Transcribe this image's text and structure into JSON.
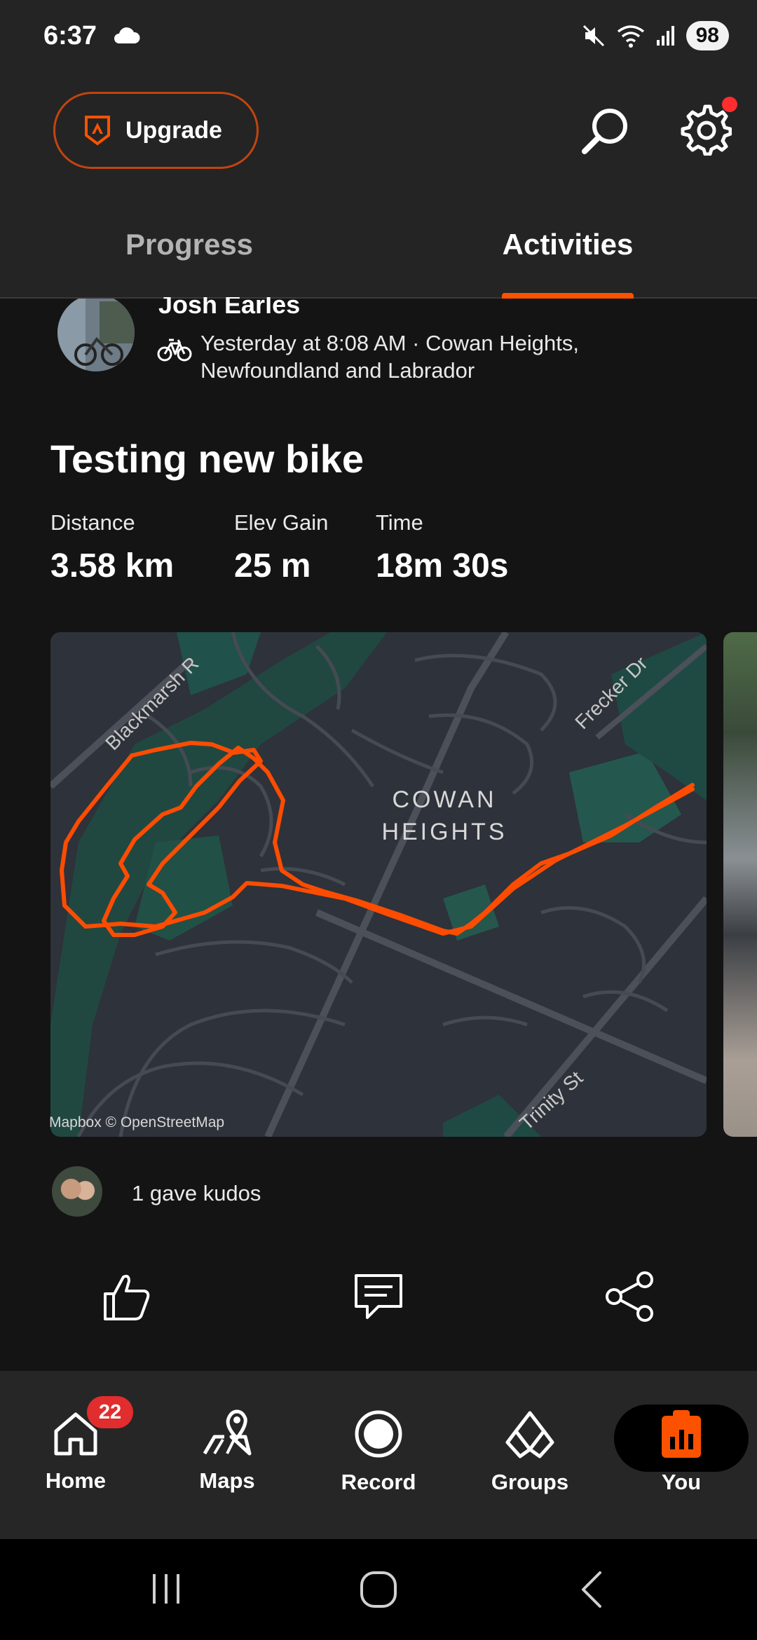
{
  "status_bar": {
    "time": "6:37",
    "battery": "98",
    "icons": [
      "cloud-icon",
      "mute-icon",
      "wifi-icon",
      "signal-icon"
    ]
  },
  "header": {
    "upgrade_label": "Upgrade",
    "tabs": [
      {
        "label": "Progress",
        "active": false
      },
      {
        "label": "Activities",
        "active": true
      }
    ],
    "accent_color": "#fc5200"
  },
  "activity": {
    "athlete": "Josh Earles",
    "meta": "Yesterday at 8:08 AM · Cowan Heights, Newfoundland and Labrador",
    "title": "Testing new bike",
    "stats": [
      {
        "label": "Distance",
        "value": "3.58 km"
      },
      {
        "label": "Elev Gain",
        "value": "25 m"
      },
      {
        "label": "Time",
        "value": "18m 30s"
      }
    ],
    "map": {
      "area_label_1": "COWAN",
      "area_label_2": "HEIGHTS",
      "streets": [
        "Blackmarsh R",
        "Frecker Dr",
        "Trinity St"
      ],
      "attribution": "Mapbox © OpenStreetMap"
    },
    "kudos_text": "1 gave kudos"
  },
  "bottom_nav": {
    "items": [
      {
        "label": "Home",
        "badge": "22"
      },
      {
        "label": "Maps"
      },
      {
        "label": "Record"
      },
      {
        "label": "Groups"
      },
      {
        "label": "You",
        "active": true
      }
    ]
  }
}
